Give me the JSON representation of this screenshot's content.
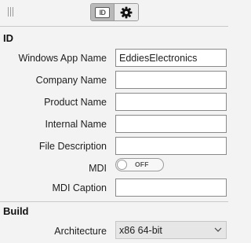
{
  "toolbar": {
    "grip_icon": "grip-icon",
    "id_tab_text": "ID",
    "settings_icon": "gear-icon"
  },
  "sections": {
    "id": {
      "title": "ID",
      "app_name_label": "Windows App Name",
      "app_name_value": "EddiesElectronics",
      "company_label": "Company Name",
      "company_value": "",
      "product_label": "Product Name",
      "product_value": "",
      "internal_label": "Internal Name",
      "internal_value": "",
      "description_label": "File Description",
      "description_value": "",
      "mdi_label": "MDI",
      "mdi_state": "OFF",
      "mdi_caption_label": "MDI Caption",
      "mdi_caption_value": ""
    },
    "build": {
      "title": "Build",
      "architecture_label": "Architecture",
      "architecture_value": "x86 64-bit"
    }
  },
  "colors": {
    "background": "#f3f3f3",
    "field_border": "#8a8a8a",
    "selected_tab": "#b9b9b9"
  }
}
